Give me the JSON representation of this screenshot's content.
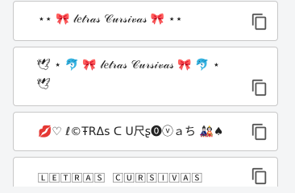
{
  "styles": [
    {
      "text": "⋆⋆ 🎀 𝓁𝑒𝓉𝓇𝒶𝓈 𝒞𝓊𝓇𝓈𝒾𝓋𝒶𝓈 🎀 ⋆⋆"
    },
    {
      "text": "🕊 ⋆ 🐬 🎀 𝓁𝑒𝓉𝓇𝒶𝓈 𝒞𝓊𝓇𝓈𝒾𝓋𝒶𝓈 🎀 🐬 ⋆ 🕊"
    },
    {
      "text": "💋♡ ℓ©ŦRΔs ᑕ ᑌ尺ʂ⓿ⓥａち 🎎♠"
    },
    {
      "text": "🄻🄴🅃🅁🄰🅂 🄲🅄🅁🅂🄸🅅🄰🅂"
    }
  ],
  "icons": {
    "copy": "copy-icon"
  },
  "colors": {
    "card_border": "#c8c8c8",
    "icon": "#555555"
  }
}
